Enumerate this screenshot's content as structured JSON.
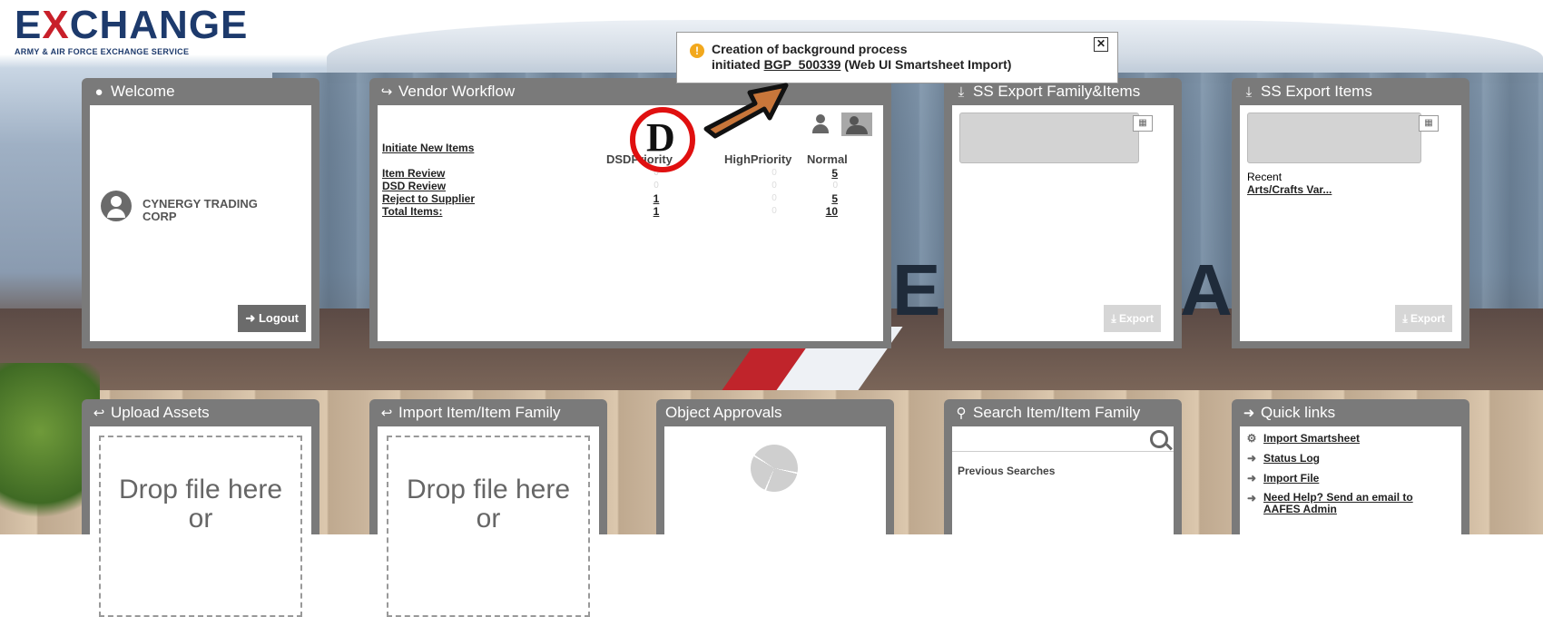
{
  "logo": {
    "main_a": "E",
    "main_b": "X",
    "main_c": "CHANGE",
    "sub": "ARMY & AIR FORCE EXCHANGE SERVICE"
  },
  "notification": {
    "line1": "Creation of background process",
    "line2_prefix": "initiated ",
    "process_id": "BGP_500339",
    "line2_suffix": " (Web UI Smartsheet Import)",
    "icon": "info-icon"
  },
  "annotation": {
    "letter": "D"
  },
  "welcome": {
    "title": "Welcome",
    "company": "CYNERGY TRADING CORP",
    "logout_label": "Logout"
  },
  "workflow": {
    "title": "Vendor Workflow",
    "initiate_label": "Initiate New Items",
    "col_dsd": "DSDPriority",
    "col_high": "HighPriority",
    "col_normal": "Normal",
    "rows": [
      {
        "label": "Item Review",
        "dsd": "0",
        "high": "0",
        "normal": "5"
      },
      {
        "label": "DSD Review",
        "dsd": "0",
        "high": "0",
        "normal": "0"
      },
      {
        "label": "Reject to Supplier",
        "dsd": "1",
        "high": "0",
        "normal": "5"
      },
      {
        "label": "Total Items:",
        "dsd": "1",
        "high": "0",
        "normal": "10"
      }
    ]
  },
  "ss_export_family": {
    "title": "SS Export Family&Items",
    "export_label": "Export"
  },
  "ss_export_items": {
    "title": "SS Export Items",
    "recent_label": "Recent",
    "recent_link": "Arts/Crafts Var...",
    "export_label": "Export"
  },
  "upload_assets": {
    "title": "Upload Assets",
    "drop_line1": "Drop file here",
    "drop_line2": "or"
  },
  "import_item": {
    "title": "Import Item/Item Family",
    "drop_line1": "Drop file here",
    "drop_line2": "or"
  },
  "approvals": {
    "title": "Object Approvals"
  },
  "search": {
    "title": "Search Item/Item Family",
    "placeholder": "",
    "previous_label": "Previous Searches"
  },
  "quick_links": {
    "title": "Quick links",
    "items": [
      {
        "label": "Import Smartsheet",
        "icon": "gear-icon"
      },
      {
        "label": "Status Log",
        "icon": "arrow-right-icon"
      },
      {
        "label": "Import File",
        "icon": "arrow-right-icon"
      },
      {
        "label": "Need Help? Send an email to AAFES Admin",
        "icon": "arrow-right-icon"
      }
    ]
  }
}
